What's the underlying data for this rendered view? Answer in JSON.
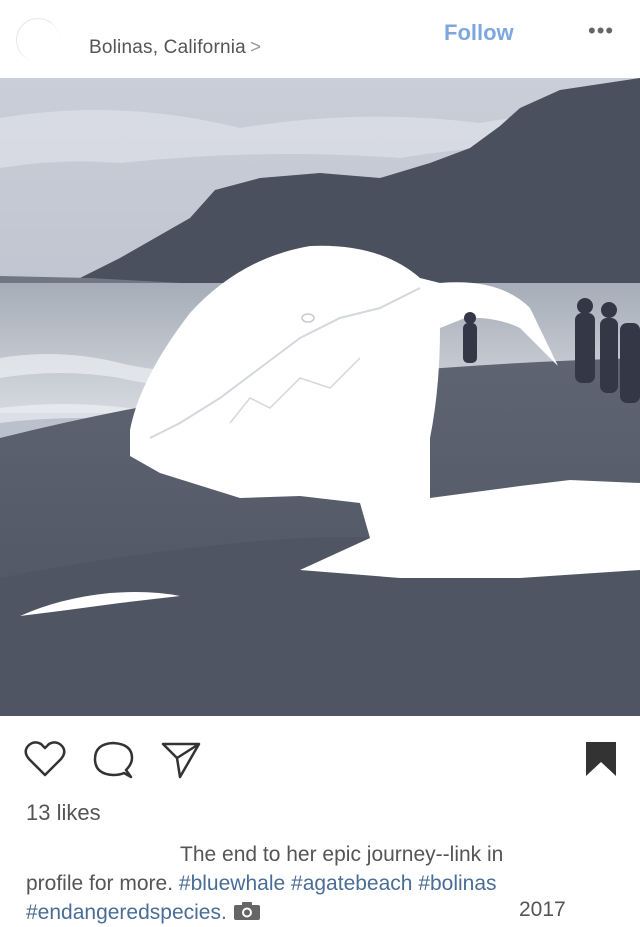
{
  "header": {
    "location": "Bolinas, California",
    "location_chevron": ">",
    "follow_label": "Follow",
    "more_label": "•••"
  },
  "actions": {
    "like": "heart-icon",
    "comment": "comment-icon",
    "share": "send-icon",
    "save": "bookmark-icon"
  },
  "post": {
    "likes": "13 likes",
    "caption_line1": "The end to her epic journey--link in",
    "caption_line2_prefix": "profile for more.",
    "hashtags": [
      "#bluewhale",
      "#agatebeach",
      "#bolinas",
      "#endangeredspecies."
    ],
    "year": "2017"
  },
  "colors": {
    "follow": "#7fa7df",
    "hashtag": "#4a6d96",
    "text": "#555555"
  }
}
